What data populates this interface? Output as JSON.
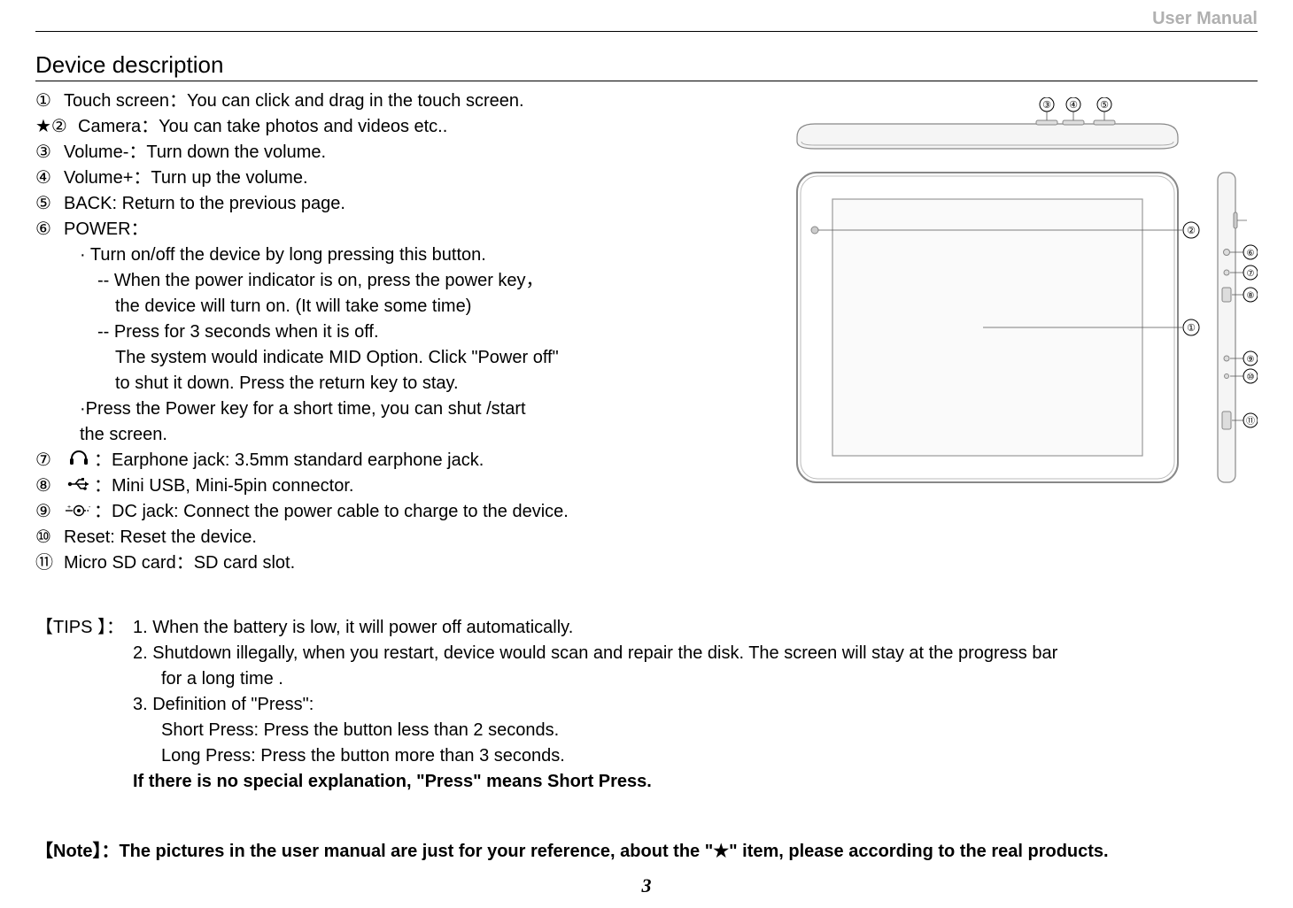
{
  "header": {
    "label": "User Manual"
  },
  "section_title": "Device description",
  "items": {
    "i1": {
      "num": "①",
      "text": "Touch screen：You can click and drag in the touch screen."
    },
    "i2": {
      "num": "★②",
      "text": "Camera：You can take photos and videos etc.."
    },
    "i3": {
      "num": "③",
      "text": "Volume-：Turn down the volume."
    },
    "i4": {
      "num": "④",
      "text": "Volume+：Turn up the volume."
    },
    "i5": {
      "num": "⑤",
      "text": "BACK: Return to the previous page."
    },
    "i6": {
      "num": "⑥",
      "text": "POWER："
    },
    "i6a": "· Turn on/off the device by long pressing this button.",
    "i6b": "-- When the power indicator is on, press the power key，",
    "i6c": "the device will turn on. (It will take some time)",
    "i6d": "-- Press for 3 seconds when it is off.",
    "i6e": "The system would indicate MID Option. Click \"Power off\"",
    "i6f": "to shut it down. Press the return key to stay.",
    "i6g": "·Press the Power key for a short time, you can shut /start",
    "i6h": "the screen.",
    "i7": {
      "num": "⑦",
      "text": "：Earphone jack: 3.5mm standard earphone jack."
    },
    "i8": {
      "num": "⑧",
      "text": "：Mini USB, Mini-5pin connector."
    },
    "i9": {
      "num": "⑨",
      "text": "：DC jack: Connect the power cable to charge to the device."
    },
    "i10": {
      "num": "⑩",
      "text": "Reset: Reset the device."
    },
    "i11": {
      "num": "⑪",
      "text": "Micro SD card：SD card slot."
    }
  },
  "tips": {
    "label": "【TIPS 】：",
    "t1": "1. When the battery is low, it will power off automatically.",
    "t2": "2. Shutdown illegally, when you restart, device would scan and repair the disk. The screen will stay at the progress bar",
    "t2b": "for a long time .",
    "t3": "3. Definition of \"Press\":",
    "t3a": "Short Press: Press the button less than 2 seconds.",
    "t3b": "Long Press: Press the button more than 3 seconds.",
    "t3c": "If there is no special explanation, \"Press\" means Short Press."
  },
  "note": "【Note】：The pictures in the user manual are just for your reference, about the \"★\" item, please according to the real products.",
  "page_number": "3",
  "callouts": {
    "c1": "①",
    "c2": "②",
    "c3": "③",
    "c4": "④",
    "c5": "⑤",
    "c6": "⑥",
    "c7": "⑦",
    "c8": "⑧",
    "c9": "⑨",
    "c10": "⑩",
    "c11": "⑪"
  }
}
